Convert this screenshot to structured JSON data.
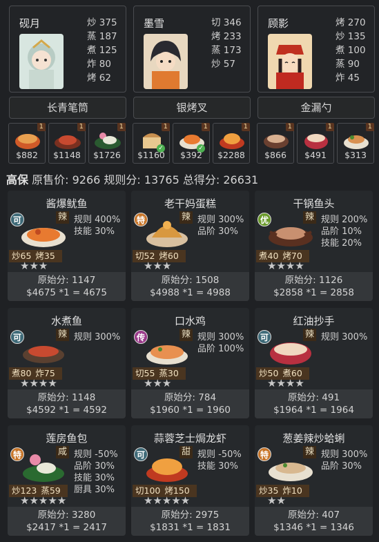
{
  "chefs": [
    {
      "name": "砚月",
      "stats": [
        "炒 375",
        "蒸 187",
        "煮 125",
        "炸 80",
        "烤 62"
      ]
    },
    {
      "name": "墨雪",
      "stats": [
        "切 346",
        "烤 233",
        "蒸 173",
        "炒 57"
      ]
    },
    {
      "name": "顾影",
      "stats": [
        "烤 270",
        "炒 135",
        "煮 100",
        "蒸 90",
        "炸 45"
      ]
    }
  ],
  "equipment": [
    "长青笔筒",
    "银烤叉",
    "金漏勺"
  ],
  "ingredients": [
    {
      "qty": "1",
      "price": "$882",
      "checked": false
    },
    {
      "qty": "1",
      "price": "$1148",
      "checked": false
    },
    {
      "qty": "1",
      "price": "$1726",
      "checked": false
    },
    {
      "qty": "1",
      "price": "$1160",
      "checked": true
    },
    {
      "qty": "1",
      "price": "$392",
      "checked": true
    },
    {
      "qty": "1",
      "price": "$2288",
      "checked": false
    },
    {
      "qty": "1",
      "price": "$866",
      "checked": false
    },
    {
      "qty": "1",
      "price": "$491",
      "checked": false
    },
    {
      "qty": "1",
      "price": "$313",
      "checked": false
    }
  ],
  "summary": {
    "mode": "高保",
    "text": "原售价: 9266 规则分: 13765 总得分: 26631"
  },
  "dishes": [
    {
      "title": "酱爆鱿鱼",
      "grade": "可",
      "grade_color": "#3e6a78",
      "flavor": "辣",
      "bonus": [
        "规则 400%",
        "技能 30%"
      ],
      "skills": [
        "炒65",
        "烤35"
      ],
      "stars": "★★★",
      "raw": "原始分: 1147",
      "calc": "$4675 *1 = 4675"
    },
    {
      "title": "老干妈蛋糕",
      "grade": "特",
      "grade_color": "#c8762a",
      "flavor": "辣",
      "bonus": [
        "规则 300%",
        "品阶 30%"
      ],
      "skills": [
        "切52",
        "烤60"
      ],
      "stars": "★★★",
      "raw": "原始分: 1508",
      "calc": "$4988 *1 = 4988"
    },
    {
      "title": "干锅鱼头",
      "grade": "优",
      "grade_color": "#6a9a2a",
      "flavor": "辣",
      "bonus": [
        "规则 200%",
        "品阶 10%",
        "技能 20%"
      ],
      "skills": [
        "煮40",
        "烤70"
      ],
      "stars": "★★★★",
      "raw": "原始分: 1126",
      "calc": "$2858 *1 = 2858"
    },
    {
      "title": "水煮鱼",
      "grade": "可",
      "grade_color": "#3e6a78",
      "flavor": "辣",
      "bonus": [
        "规则 300%"
      ],
      "skills": [
        "煮80",
        "炸75"
      ],
      "stars": "★★★★",
      "raw": "原始分: 1148",
      "calc": "$4592 *1 = 4592"
    },
    {
      "title": "口水鸡",
      "grade": "传",
      "grade_color": "#9a3a8a",
      "flavor": "辣",
      "bonus": [
        "规则 300%",
        "品阶 100%"
      ],
      "skills": [
        "切55",
        "蒸30"
      ],
      "stars": "★★★",
      "raw": "原始分: 784",
      "calc": "$1960 *1 = 1960"
    },
    {
      "title": "红油抄手",
      "grade": "可",
      "grade_color": "#3e6a78",
      "flavor": "辣",
      "bonus": [
        "规则 300%"
      ],
      "skills": [
        "炒50",
        "煮60"
      ],
      "stars": "★★★★",
      "raw": "原始分: 491",
      "calc": "$1964 *1 = 1964"
    },
    {
      "title": "莲房鱼包",
      "grade": "特",
      "grade_color": "#c8762a",
      "flavor": "咸",
      "bonus": [
        "规则 -50%",
        "品阶 30%",
        "技能 30%",
        "厨具 30%"
      ],
      "skills": [
        "炒123",
        "蒸59"
      ],
      "stars": "★★★★★",
      "raw": "原始分: 3280",
      "calc": "$2417 *1 = 2417"
    },
    {
      "title": "蒜蓉芝士焗龙虾",
      "grade": "可",
      "grade_color": "#3e6a78",
      "flavor": "甜",
      "bonus": [
        "规则 -50%",
        "技能 30%"
      ],
      "skills": [
        "切100",
        "烤150"
      ],
      "stars": "★★★★★",
      "raw": "原始分: 2975",
      "calc": "$1831 *1 = 1831"
    },
    {
      "title": "葱姜辣炒蛤蜊",
      "grade": "特",
      "grade_color": "#c8762a",
      "flavor": "辣",
      "bonus": [
        "规则 300%",
        "品阶 30%"
      ],
      "skills": [
        "炒35",
        "炸10"
      ],
      "stars": "★★",
      "raw": "原始分: 407",
      "calc": "$1346 *1 = 1346"
    }
  ]
}
